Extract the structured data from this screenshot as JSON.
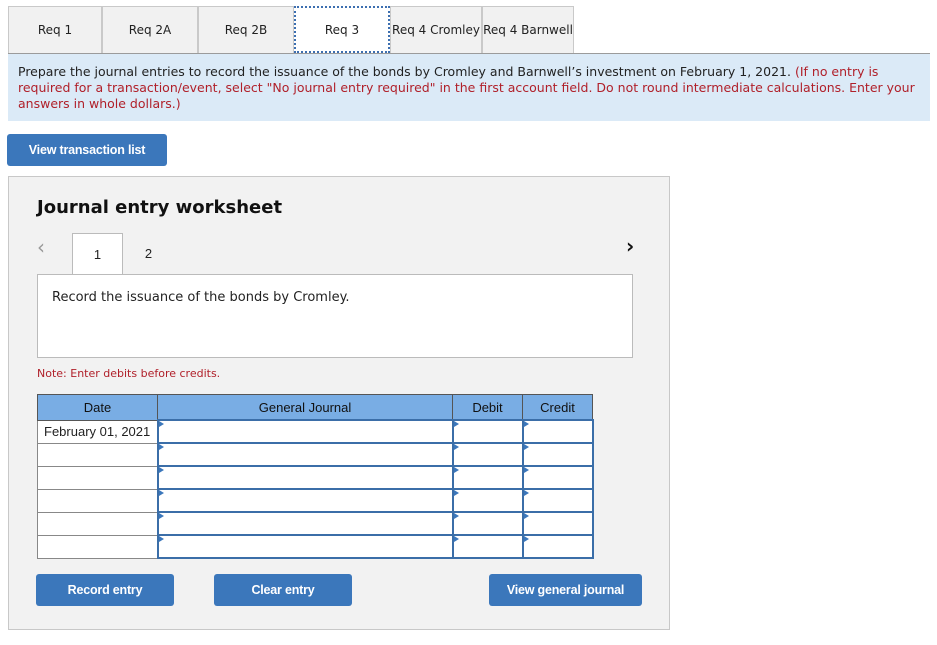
{
  "tabs": [
    {
      "label": "Req 1",
      "active": false
    },
    {
      "label": "Req 2A",
      "active": false
    },
    {
      "label": "Req 2B",
      "active": false
    },
    {
      "label": "Req 3",
      "active": true
    },
    {
      "label": "Req 4 Cromley",
      "active": false
    },
    {
      "label": "Req 4 Barnwell",
      "active": false
    }
  ],
  "instructions": {
    "main": "Prepare the journal entries to record the issuance of the bonds by Cromley and Barnwell’s investment on February 1, 2021.",
    "note": "(If no entry is required for a transaction/event, select \"No journal entry required\" in the first account field. Do not round intermediate calculations. Enter your answers in whole dollars.)"
  },
  "view_transaction_list_label": "View transaction list",
  "worksheet": {
    "title": "Journal entry worksheet",
    "prev_icon": "chevron-left-icon",
    "next_icon": "chevron-right-icon",
    "pages": [
      "1",
      "2"
    ],
    "active_page": "1",
    "description": "Record the issuance of the bonds by Cromley.",
    "note": "Note: Enter debits before credits.",
    "table": {
      "headers": [
        "Date",
        "General Journal",
        "Debit",
        "Credit"
      ],
      "rows": [
        {
          "date": "February 01, 2021",
          "account": "",
          "debit": "",
          "credit": ""
        },
        {
          "date": "",
          "account": "",
          "debit": "",
          "credit": ""
        },
        {
          "date": "",
          "account": "",
          "debit": "",
          "credit": ""
        },
        {
          "date": "",
          "account": "",
          "debit": "",
          "credit": ""
        },
        {
          "date": "",
          "account": "",
          "debit": "",
          "credit": ""
        },
        {
          "date": "",
          "account": "",
          "debit": "",
          "credit": ""
        }
      ]
    },
    "buttons": {
      "record": "Record entry",
      "clear": "Clear entry",
      "view_journal": "View general journal"
    }
  },
  "colors": {
    "button": "#3b77bb",
    "header": "#79ade4",
    "note_red": "#b0202a",
    "instr_bg": "#dbeaf7"
  }
}
